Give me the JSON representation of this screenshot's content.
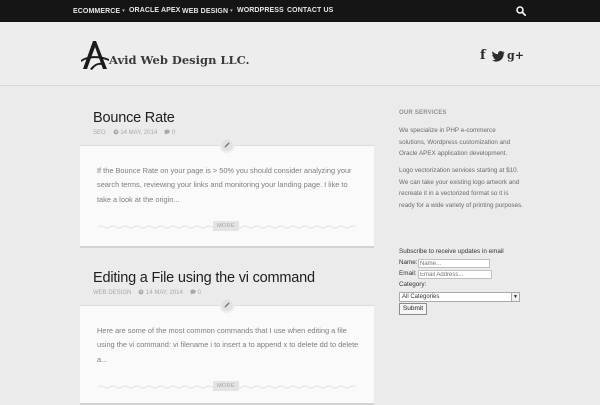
{
  "topnav": {
    "items": [
      {
        "label": "ECOMMERCE",
        "has_dropdown": true
      },
      {
        "label": "ORACLE APEX",
        "has_dropdown": false
      },
      {
        "label": "WEB DESIGN",
        "has_dropdown": true
      },
      {
        "label": "WORDPRESS",
        "has_dropdown": false
      },
      {
        "label": "CONTACT US",
        "has_dropdown": false
      }
    ],
    "caret": "▾",
    "search_icon": "search-icon"
  },
  "header": {
    "logo_text": "Avid Web Design LLC.",
    "social": {
      "facebook": "f",
      "twitter_icon": "twitter-icon",
      "googleplus": "g+"
    }
  },
  "posts": [
    {
      "title": "Bounce Rate",
      "category": "SEO",
      "date": "14 MAY, 2014",
      "comments": "0",
      "excerpt": "If the Bounce Rate on your page is > 50% you should consider analyzing your search terms, reviewing your links and monitoring your landing page. I like to take a look at the origin...",
      "more_label": "MORE"
    },
    {
      "title": "Editing a File using the vi command",
      "category": "WEB DESIGN",
      "date": "14 MAY, 2014",
      "comments": "0",
      "excerpt": "Here are some of the most common commands that I use when editing a file using the vi command: vi filename i to insert a to append x to delete dd to delete a...",
      "more_label": "MORE"
    }
  ],
  "sidebar": {
    "heading": "OUR SERVICES",
    "para1": "We specialize in PHP e-commerce solutions, Wordpress customization and Oracle APEX application development.",
    "para2": "Logo vectorization services starting at $10. We can take your existing logo artwork and recreate it in a vectorized format so it is ready for a wide variety of printing purposes.",
    "subscribe_text": "Subscribe to receive updates in email",
    "name_label": "Name:",
    "name_placeholder": "Name...",
    "email_label": "Email:",
    "email_placeholder": "Email Address...",
    "category_label": "Category:",
    "category_selected": "All Categories",
    "submit_label": "Submit"
  },
  "colors": {
    "nav_bg": "#151515",
    "page_bg": "#ebebeb",
    "card_bg": "#fafafa",
    "meta_gray": "#a8a8a8"
  }
}
